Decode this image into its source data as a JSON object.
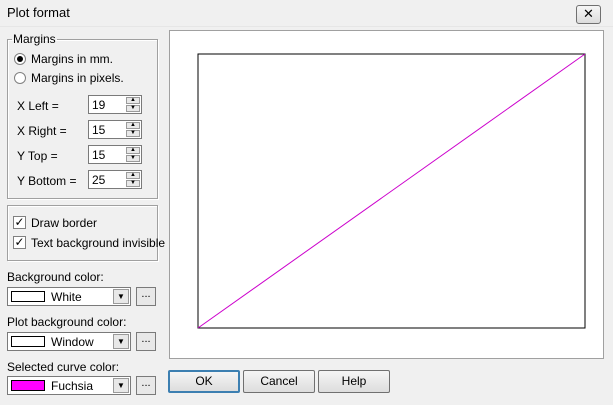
{
  "window": {
    "title": "Plot format",
    "close_glyph": "✕"
  },
  "margins": {
    "legend": "Margins",
    "radio_mm": "Margins in mm.",
    "radio_pixels": "Margins in pixels.",
    "selected": "mm",
    "left_label": "X Left =",
    "right_label": "X Right =",
    "top_label": "Y Top =",
    "bottom_label": "Y Bottom =",
    "left": "19",
    "right": "15",
    "top": "15",
    "bottom": "25"
  },
  "options": {
    "draw_border_label": "Draw border",
    "draw_border": true,
    "text_bg_label": "Text background invisible",
    "text_bg_invisible": true
  },
  "colors": {
    "background_label": "Background color:",
    "background_value": "White",
    "background_swatch": "#ffffff",
    "plot_bg_label": "Plot background color:",
    "plot_bg_value": "Window",
    "plot_bg_swatch": "#ffffff",
    "curve_label": "Selected curve color:",
    "curve_value": "Fuchsia",
    "curve_swatch": "#ff00ff",
    "more_label": "..."
  },
  "preview": {
    "curve_color": "#cc00cc"
  },
  "buttons": {
    "ok": "OK",
    "cancel": "Cancel",
    "help": "Help"
  }
}
